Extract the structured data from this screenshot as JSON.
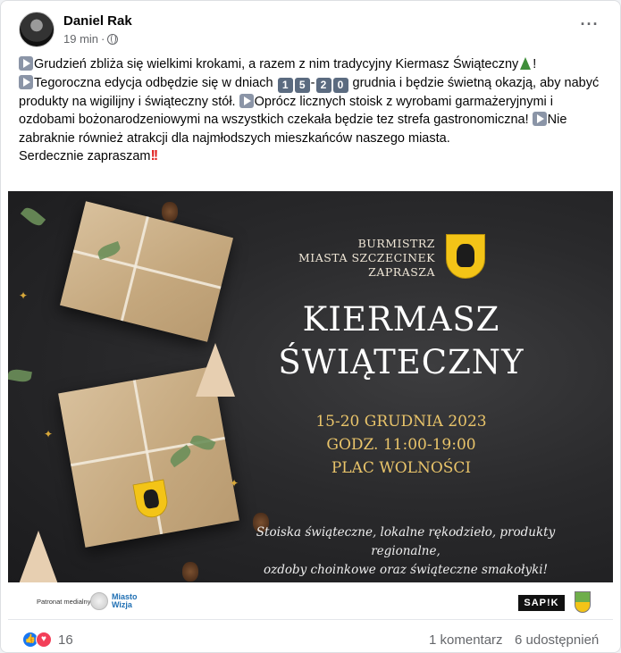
{
  "post": {
    "author": "Daniel Rak",
    "time": "19 min",
    "dot": "·",
    "more": "···",
    "text": {
      "p1": "Grudzień zbliża się wielkimi krokami, a razem z nim tradycyjny Kiermasz Świąteczny",
      "p1_end": "!",
      "p2a": "Tegoroczna edycja odbędzie się w dniach ",
      "day_start_1": "1",
      "day_start_2": "5",
      "dash": "-",
      "day_end_1": "2",
      "day_end_2": "0",
      "p2b": " grudnia i będzie świetną okazją, aby nabyć produkty na wigilijny i świąteczny stół. ",
      "p3": "Oprócz licznych stoisk z wyrobami garmażeryjnymi i ozdobami bożonarodzeniowymi na wszystkich czekała będzie tez strefa gastronomiczna! ",
      "p4": "Nie zabraknie również atrakcji dla najmłodszych mieszkańców naszego miasta.",
      "closing": "Serdecznie zapraszam",
      "bangs": "!!"
    },
    "icons": [
      "play-icon",
      "christmas-tree-emoji",
      "keycap-digit",
      "double-exclamation-emoji",
      "globe-icon"
    ]
  },
  "poster": {
    "mayor_line1": "Burmistrz",
    "mayor_line2": "Miasta Szczecinek",
    "mayor_line3": "zaprasza",
    "title_line1": "Kiermasz",
    "title_line2": "Świąteczny",
    "dates": "15-20 grudnia 2023",
    "hours": "godz. 11:00-19:00",
    "place": "Plac Wolności",
    "tagline_line1": "Stoiska świąteczne, lokalne rękodzieło, produkty regionalne,",
    "tagline_line2": "ozdoby choinkowe oraz świąteczne smakołyki!",
    "colors": {
      "gold": "#e9c46a",
      "background": "#2a2a2c"
    }
  },
  "sponsors": {
    "patron_label": "Patronat medialny",
    "miasto": "Miasto",
    "wizja": "Wizja",
    "sapik": "SAP!K"
  },
  "footer": {
    "reaction_count": "16",
    "comments": "1 komentarz",
    "shares": "6 udostępnień",
    "like_color": "#1877f2",
    "love_color": "#f33e58"
  }
}
